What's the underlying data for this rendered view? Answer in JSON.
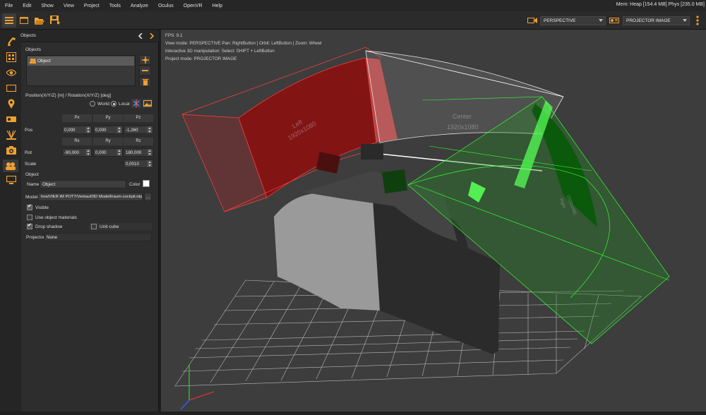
{
  "menu": [
    "File",
    "Edit",
    "Show",
    "View",
    "Project",
    "Tools",
    "Analyze",
    "Oculus",
    "OpenVR",
    "Help"
  ],
  "memory": "Mem: Heap [154.4 MB] Phys [235.0 MB]",
  "toolbar": {
    "view_combo": "PERSPECTIVE",
    "projector_combo": "PROJECTOR IMAGE"
  },
  "panel": {
    "title": "Objects",
    "objects_label": "Objects",
    "object_list": [
      "Object"
    ],
    "transform_label": "Position(X/Y/Z) [m] / Rotation(X/Y/Z) [deg]",
    "world_label": "World",
    "local_label": "Local",
    "pos_headers": [
      "Px",
      "Py",
      "Pz"
    ],
    "pos_label": "Pos",
    "pos_values": [
      "0,000",
      "0,000",
      "-1,260"
    ],
    "rot_headers": [
      "Rx",
      "Ry",
      "Rz"
    ],
    "rot_label": "Rot",
    "rot_values": [
      "-90,000",
      "0,000",
      "180,000"
    ],
    "scale_label": "Scale",
    "scale_value": "0,0010",
    "object_section": "Object",
    "name_label": "Name",
    "name_value": "Object",
    "color_label": "Color",
    "model_label": "Model",
    "model_value": "hne/VIER IM POTT/Verkauf/3D Modell/raum-cockpit.obj",
    "model_browse": "...",
    "visible_label": "Visible",
    "use_materials_label": "Use object materials",
    "drop_shadow_label": "Drop shadow",
    "unit_cube_label": "Unit cube",
    "projector_label": "Projector",
    "projector_value": "None"
  },
  "viewport": {
    "fps": "FPS: 9.1",
    "view_mode": "View mode: PERSPECTIVE Pan: RightButton | Orbit: LeftButton | Zoom: Wheel",
    "manipulation": "Interactive 3D manipulation: Select: SHIFT + LeftButton",
    "project_mode": "Project mode: PROJECTOR IMAGE",
    "left_screen_label": "Left",
    "left_screen_res": "1920x1080",
    "center_screen_label": "Center",
    "center_screen_res": "1920x1080",
    "right_screen_label": "Right",
    "right_screen_res": "1920x1080"
  },
  "colors": {
    "accent": "#f0a030",
    "red_projector": "#cc1a1a",
    "green_projector": "#22cc22",
    "grid": "#bdbdbd"
  }
}
